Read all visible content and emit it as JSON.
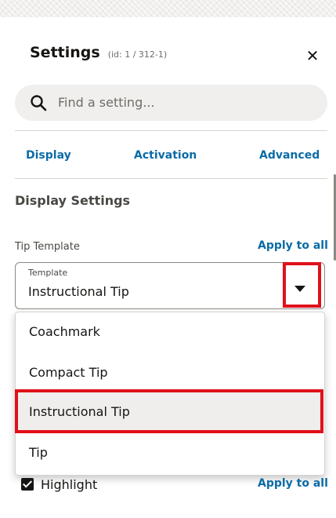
{
  "header": {
    "title": "Settings",
    "id_text": "(id: 1 / 312-1)",
    "close_icon": "close-icon"
  },
  "search": {
    "placeholder": "Find a setting...",
    "icon": "search-icon"
  },
  "tabs": [
    {
      "label": "Display"
    },
    {
      "label": "Activation"
    },
    {
      "label": "Advanced"
    }
  ],
  "section": {
    "title": "Display Settings"
  },
  "tip_template": {
    "label": "Tip Template",
    "apply_label": "Apply to all",
    "select": {
      "floating_label": "Template",
      "value": "Instructional Tip",
      "icon": "chevron-down-icon"
    },
    "options": [
      {
        "label": "Coachmark"
      },
      {
        "label": "Compact Tip"
      },
      {
        "label": "Instructional Tip"
      },
      {
        "label": "Tip"
      }
    ]
  },
  "highlight": {
    "label": "Highlight",
    "checked": true,
    "apply_label": "Apply to all"
  },
  "colors": {
    "link": "#0b6ba6",
    "annotation_red": "#e0101a",
    "search_bg": "#f1efed"
  }
}
